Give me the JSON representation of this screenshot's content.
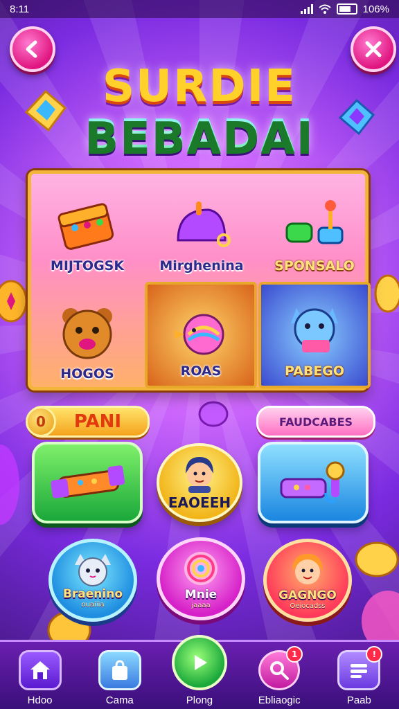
{
  "status_bar": {
    "time": "8:11",
    "battery": "106%"
  },
  "header": {
    "back_icon": "back-arrow-icon",
    "menu_icon": "puzzle-icon",
    "title_line1": "SURDIE",
    "title_line2": "BEBADAI"
  },
  "board": {
    "tiles": [
      {
        "label": "MIJTOGSK",
        "icon": "chest-icon"
      },
      {
        "label": "Mirghenina",
        "icon": "helmet-icon"
      },
      {
        "label": "SPONSALO",
        "icon": "joystick-icon"
      },
      {
        "label": "HOGOS",
        "icon": "bear-icon"
      },
      {
        "label": "ROAS",
        "icon": "candy-bird-icon"
      },
      {
        "label": "PABEGO",
        "icon": "cat-icon"
      }
    ]
  },
  "pills": {
    "left_label": "PANI",
    "left_coin": "0",
    "right_label": "FAUDCABES"
  },
  "action_buttons": {
    "green_icon": "candy-bar-icon",
    "center_label": "EAOEEH",
    "blue_icon": "microphone-icon"
  },
  "circle_buttons": [
    {
      "label": "Braenino",
      "sub": "ouaiiia"
    },
    {
      "label": "Mnie",
      "sub": "jaaaa"
    },
    {
      "label": "GAGNGO",
      "sub": "Oeiocadss"
    }
  ],
  "bottom_nav": [
    {
      "label": "Hdoo",
      "icon": "home-icon"
    },
    {
      "label": "Cama",
      "icon": "shop-bag-icon"
    },
    {
      "label": "Plong",
      "icon": "play-icon"
    },
    {
      "label": "Ebliaogic",
      "icon": "search-icon",
      "badge": "1"
    },
    {
      "label": "Paab",
      "icon": "list-icon",
      "badge": "!"
    }
  ],
  "colors": {
    "accent_pink": "#e0157f",
    "gold": "#f3b63a",
    "purple_bg": "#7a2be0"
  }
}
